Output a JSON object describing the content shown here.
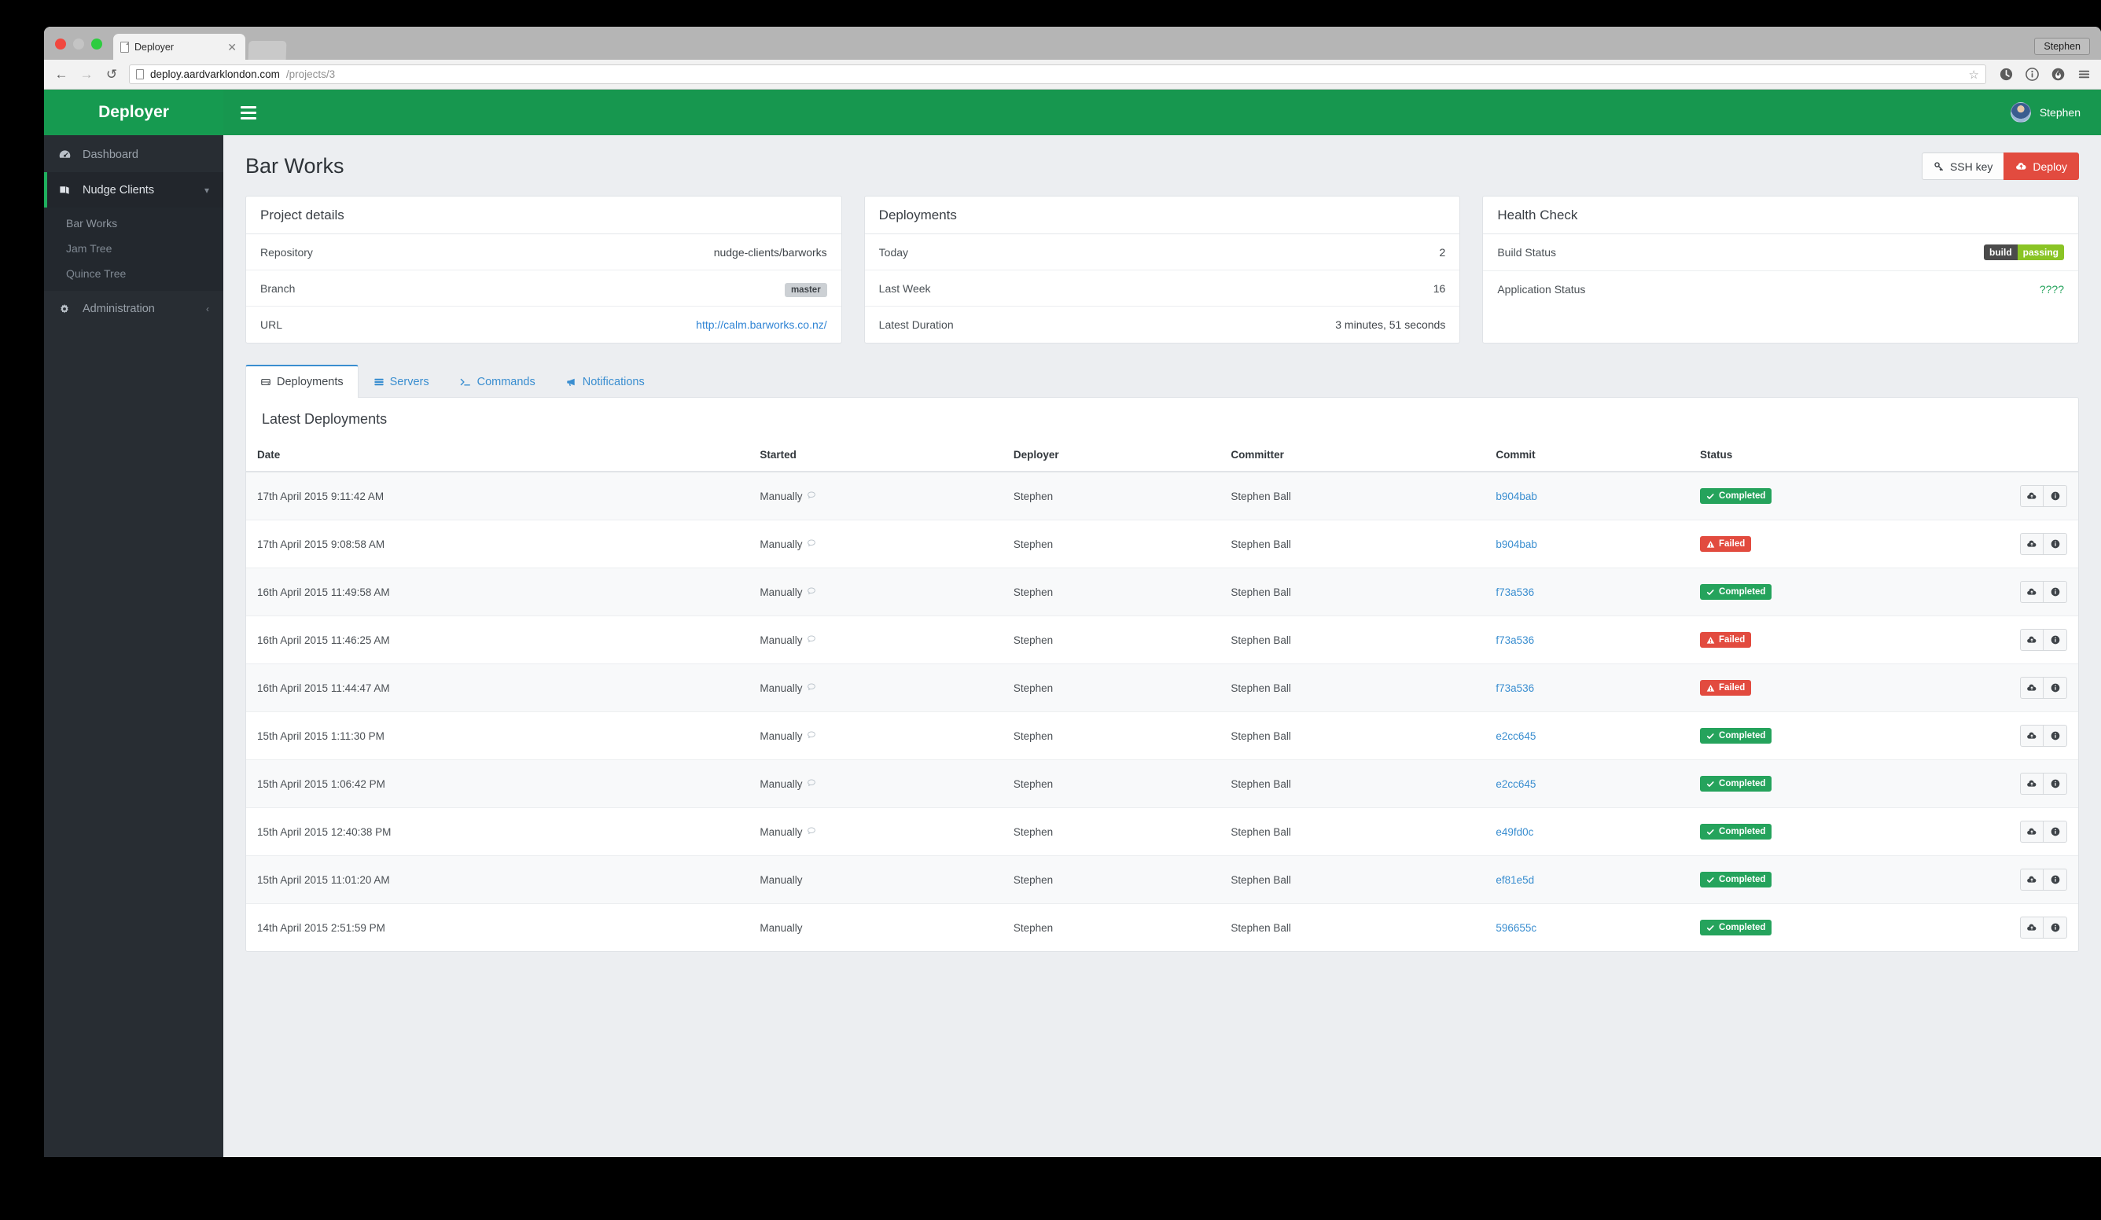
{
  "browser": {
    "tab_title": "Deployer",
    "profile_button": "Stephen",
    "url_strong": "deploy.aardvarklondon.com",
    "url_dim": "/projects/3",
    "back_icon": "back-arrow-icon",
    "forward_icon": "forward-arrow-icon",
    "reload_icon": "reload-icon",
    "star_icon": "bookmark-star-icon",
    "toolbar_icons": [
      "clock-icon",
      "info-circle-icon",
      "flame-icon",
      "hamburger-menu-icon"
    ]
  },
  "navbar": {
    "brand": "Deployer",
    "toggle_icon": "hamburger-menu-icon",
    "user": "Stephen"
  },
  "sidebar": {
    "items": [
      {
        "label": "Dashboard",
        "icon": "dashboard-icon",
        "active": false
      },
      {
        "label": "Nudge Clients",
        "icon": "book-icon",
        "active": true,
        "caret": "chevron-down-icon"
      },
      {
        "label": "Administration",
        "icon": "gear-icon",
        "active": false,
        "caret": "chevron-left-icon"
      }
    ],
    "sub_items": [
      {
        "label": "Bar Works",
        "current": true
      },
      {
        "label": "Jam Tree",
        "current": false
      },
      {
        "label": "Quince Tree",
        "current": false
      }
    ]
  },
  "page": {
    "title": "Bar Works",
    "ssh_key_button": "SSH key",
    "deploy_button": "Deploy"
  },
  "cards": {
    "project_details": {
      "title": "Project details",
      "rows": [
        {
          "label": "Repository",
          "value": "nudge-clients/barworks",
          "type": "text"
        },
        {
          "label": "Branch",
          "value": "master",
          "type": "badge"
        },
        {
          "label": "URL",
          "value": "http://calm.barworks.co.nz/",
          "type": "link"
        }
      ]
    },
    "deployments": {
      "title": "Deployments",
      "rows": [
        {
          "label": "Today",
          "value": "2"
        },
        {
          "label": "Last Week",
          "value": "16"
        },
        {
          "label": "Latest Duration",
          "value": "3 minutes, 51 seconds"
        }
      ]
    },
    "health_check": {
      "title": "Health Check",
      "rows": [
        {
          "label": "Build Status",
          "type": "build-badge",
          "badge_left": "build",
          "badge_right": "passing"
        },
        {
          "label": "Application Status",
          "type": "unknown",
          "value": "????"
        }
      ]
    }
  },
  "tabs": [
    {
      "label": "Deployments",
      "icon": "hard-drive-icon",
      "active": true
    },
    {
      "label": "Servers",
      "icon": "server-list-icon",
      "active": false
    },
    {
      "label": "Commands",
      "icon": "terminal-prompt-icon",
      "active": false
    },
    {
      "label": "Notifications",
      "icon": "megaphone-icon",
      "active": false
    }
  ],
  "table": {
    "section_title": "Latest Deployments",
    "columns": [
      "Date",
      "Started",
      "Deployer",
      "Committer",
      "Commit",
      "Status",
      ""
    ],
    "rows": [
      {
        "date": "17th April 2015 9:11:42 AM",
        "started": "Manually",
        "has_note": true,
        "deployer": "Stephen",
        "committer": "Stephen Ball",
        "commit": "b904bab",
        "status": "Completed",
        "status_type": "ok"
      },
      {
        "date": "17th April 2015 9:08:58 AM",
        "started": "Manually",
        "has_note": true,
        "deployer": "Stephen",
        "committer": "Stephen Ball",
        "commit": "b904bab",
        "status": "Failed",
        "status_type": "fail"
      },
      {
        "date": "16th April 2015 11:49:58 AM",
        "started": "Manually",
        "has_note": true,
        "deployer": "Stephen",
        "committer": "Stephen Ball",
        "commit": "f73a536",
        "status": "Completed",
        "status_type": "ok"
      },
      {
        "date": "16th April 2015 11:46:25 AM",
        "started": "Manually",
        "has_note": true,
        "deployer": "Stephen",
        "committer": "Stephen Ball",
        "commit": "f73a536",
        "status": "Failed",
        "status_type": "fail"
      },
      {
        "date": "16th April 2015 11:44:47 AM",
        "started": "Manually",
        "has_note": true,
        "deployer": "Stephen",
        "committer": "Stephen Ball",
        "commit": "f73a536",
        "status": "Failed",
        "status_type": "fail"
      },
      {
        "date": "15th April 2015 1:11:30 PM",
        "started": "Manually",
        "has_note": true,
        "deployer": "Stephen",
        "committer": "Stephen Ball",
        "commit": "e2cc645",
        "status": "Completed",
        "status_type": "ok"
      },
      {
        "date": "15th April 2015 1:06:42 PM",
        "started": "Manually",
        "has_note": true,
        "deployer": "Stephen",
        "committer": "Stephen Ball",
        "commit": "e2cc645",
        "status": "Completed",
        "status_type": "ok"
      },
      {
        "date": "15th April 2015 12:40:38 PM",
        "started": "Manually",
        "has_note": true,
        "deployer": "Stephen",
        "committer": "Stephen Ball",
        "commit": "e49fd0c",
        "status": "Completed",
        "status_type": "ok"
      },
      {
        "date": "15th April 2015 11:01:20 AM",
        "started": "Manually",
        "has_note": false,
        "deployer": "Stephen",
        "committer": "Stephen Ball",
        "commit": "ef81e5d",
        "status": "Completed",
        "status_type": "ok"
      },
      {
        "date": "14th April 2015 2:51:59 PM",
        "started": "Manually",
        "has_note": false,
        "deployer": "Stephen",
        "committer": "Stephen Ball",
        "commit": "596655c",
        "status": "Completed",
        "status_type": "ok"
      }
    ],
    "row_actions": [
      "redeploy-cloud-upload-icon",
      "details-info-icon"
    ]
  },
  "colors": {
    "brand_green": "#17974f",
    "sidebar_dark": "#282d33",
    "accent_blue": "#3a8ed0",
    "danger_red": "#e24b3f",
    "success_green": "#25a35c",
    "badge_build_right": "#8ac425",
    "page_bg": "#eceef1"
  }
}
